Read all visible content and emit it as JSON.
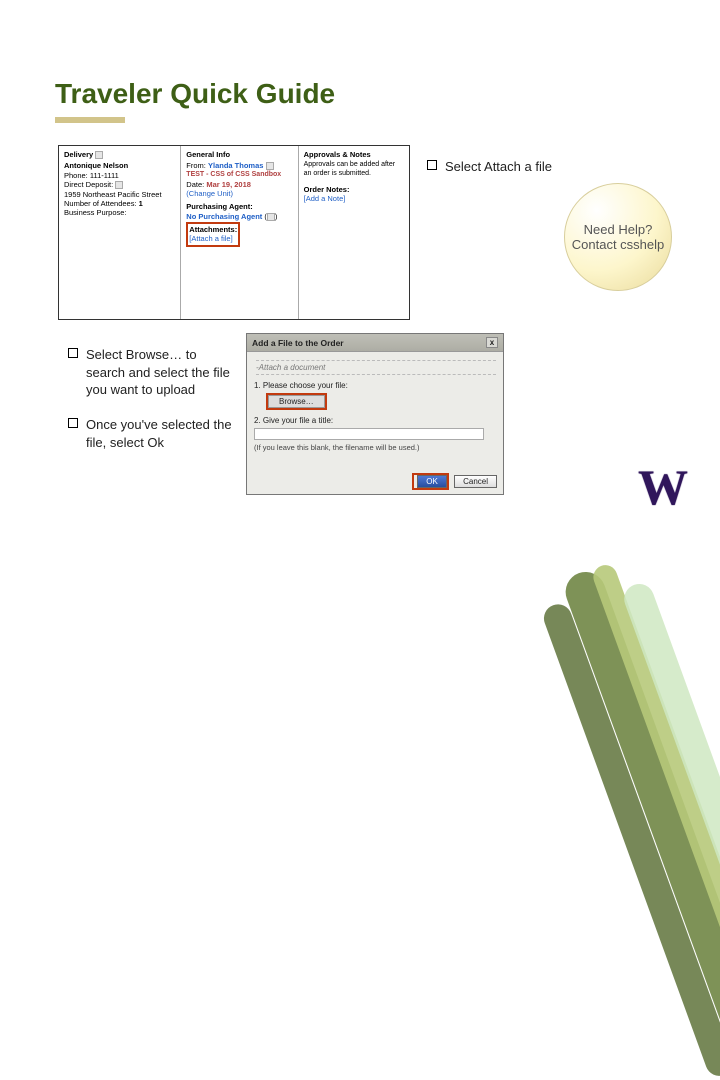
{
  "title": "Traveler Quick Guide",
  "help_circle": "Need Help? Contact csshelp",
  "bullets": {
    "b1": "Select Attach a file",
    "b2": "Select Browse… to search and select the file you want to upload",
    "b3": "Once you've selected the file, select Ok"
  },
  "panel1": {
    "delivery": {
      "heading": "Delivery",
      "name_lbl": "Antonique Nelson",
      "phone_lbl": "Phone:",
      "phone_val": "111-1111",
      "deposit_lbl": "Direct Deposit:",
      "addr": "1959 Northeast Pacific Street",
      "attendees_lbl": "Number of Attendees:",
      "attendees_val": "1",
      "purpose_lbl": "Business Purpose:"
    },
    "general": {
      "heading": "General Info",
      "from_lbl": "From:",
      "from_val": "Ylanda Thomas",
      "test_line": "TEST - CSS of CSS Sandbox",
      "date_lbl": "Date:",
      "date_val": "Mar 19, 2018",
      "change_unit": "(Change Unit)",
      "pa_lbl": "Purchasing Agent:",
      "pa_val": "No Purchasing Agent",
      "attach_lbl": "Attachments:",
      "attach_link": "[Attach a file]"
    },
    "approvals": {
      "heading": "Approvals & Notes",
      "note": "Approvals can be added after an order is submitted.",
      "notes_lbl": "Order Notes:",
      "add_note": "[Add a Note]"
    }
  },
  "panel2": {
    "title": "Add a File to the Order",
    "close": "x",
    "sub": "-Attach a document",
    "step1": "1. Please choose your file:",
    "browse": "Browse…",
    "step2": "2. Give your file a title:",
    "hint": "(If you leave this blank, the filename will be used.)",
    "ok": "OK",
    "cancel": "Cancel"
  },
  "logo": "W"
}
